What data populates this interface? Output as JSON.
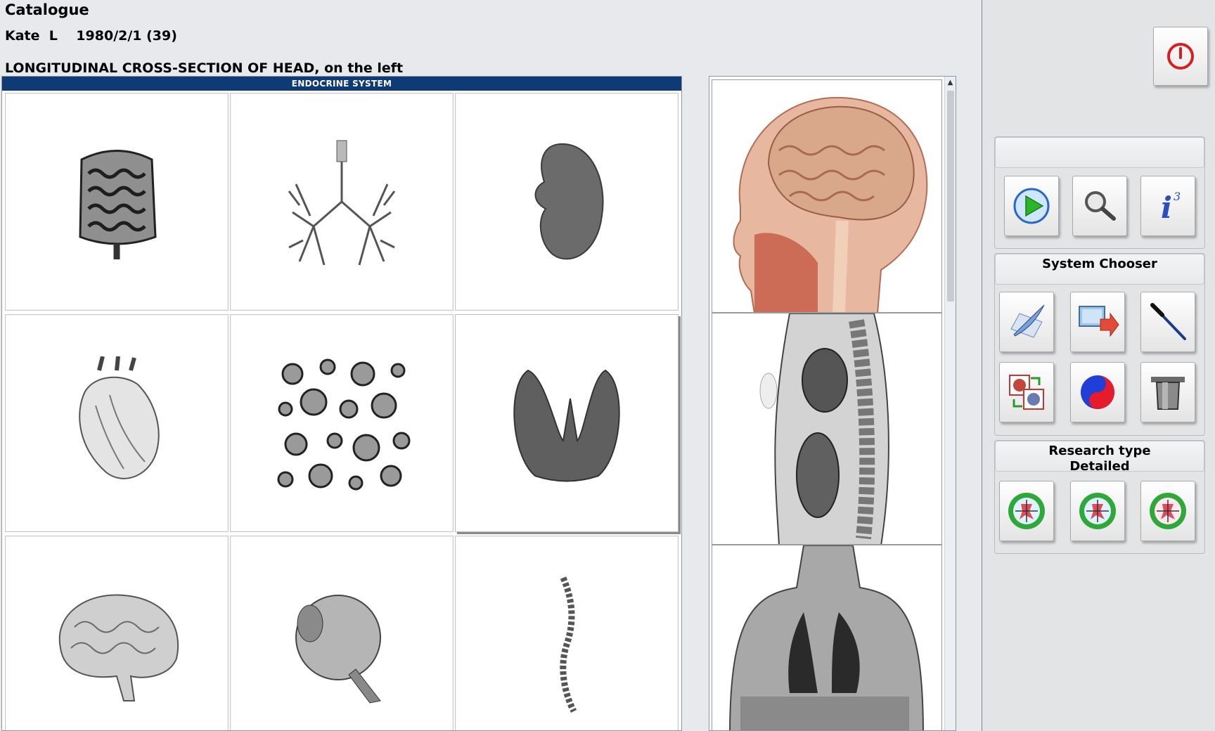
{
  "header": {
    "title": "Catalogue",
    "patient": "Kate  L    1980/2/1 (39)",
    "section": "LONGITUDINAL CROSS-SECTION OF HEAD, on the left"
  },
  "grid": {
    "title": "ENDOCRINE SYSTEM",
    "selected_index": 5,
    "items": [
      "intestines",
      "bronchial-tree",
      "kidney",
      "heart",
      "blood-cells",
      "thyroid-gland",
      "brain",
      "eyeball",
      "spine"
    ]
  },
  "scans": [
    "head-cross-section",
    "torso-sagittal-section",
    "chest-coronal-section"
  ],
  "side": {
    "power": "power-icon",
    "top_group_title": "",
    "system_chooser_title": "System Chooser",
    "research_type_line1": "Research type",
    "research_type_line2": "Detailed",
    "tools1": [
      "play-icon",
      "magnifier-icon",
      "info-icon"
    ],
    "tools2": [
      "quill-icon",
      "monitor-export-icon",
      "probe-icon",
      "organ-swap-icon",
      "yin-yang-icon",
      "pot-icon"
    ],
    "tools3": [
      "target-clock-icon",
      "target-clock-icon",
      "target-clock-icon"
    ]
  },
  "colors": {
    "header_bar": "#0e3b75",
    "power_red": "#d81f1f",
    "target_green": "#2fa83a"
  }
}
